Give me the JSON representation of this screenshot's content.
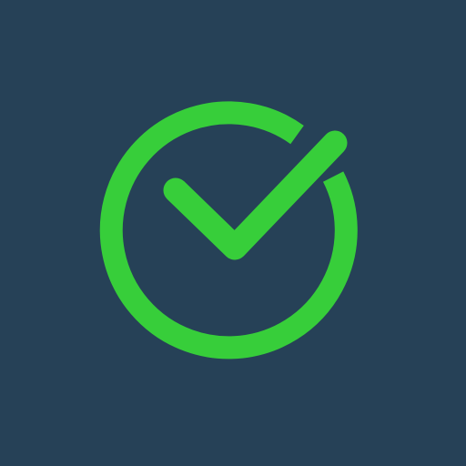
{
  "icon": {
    "name": "check-circle-icon",
    "background_color": "#264157",
    "accent_color": "#37CE3A"
  }
}
